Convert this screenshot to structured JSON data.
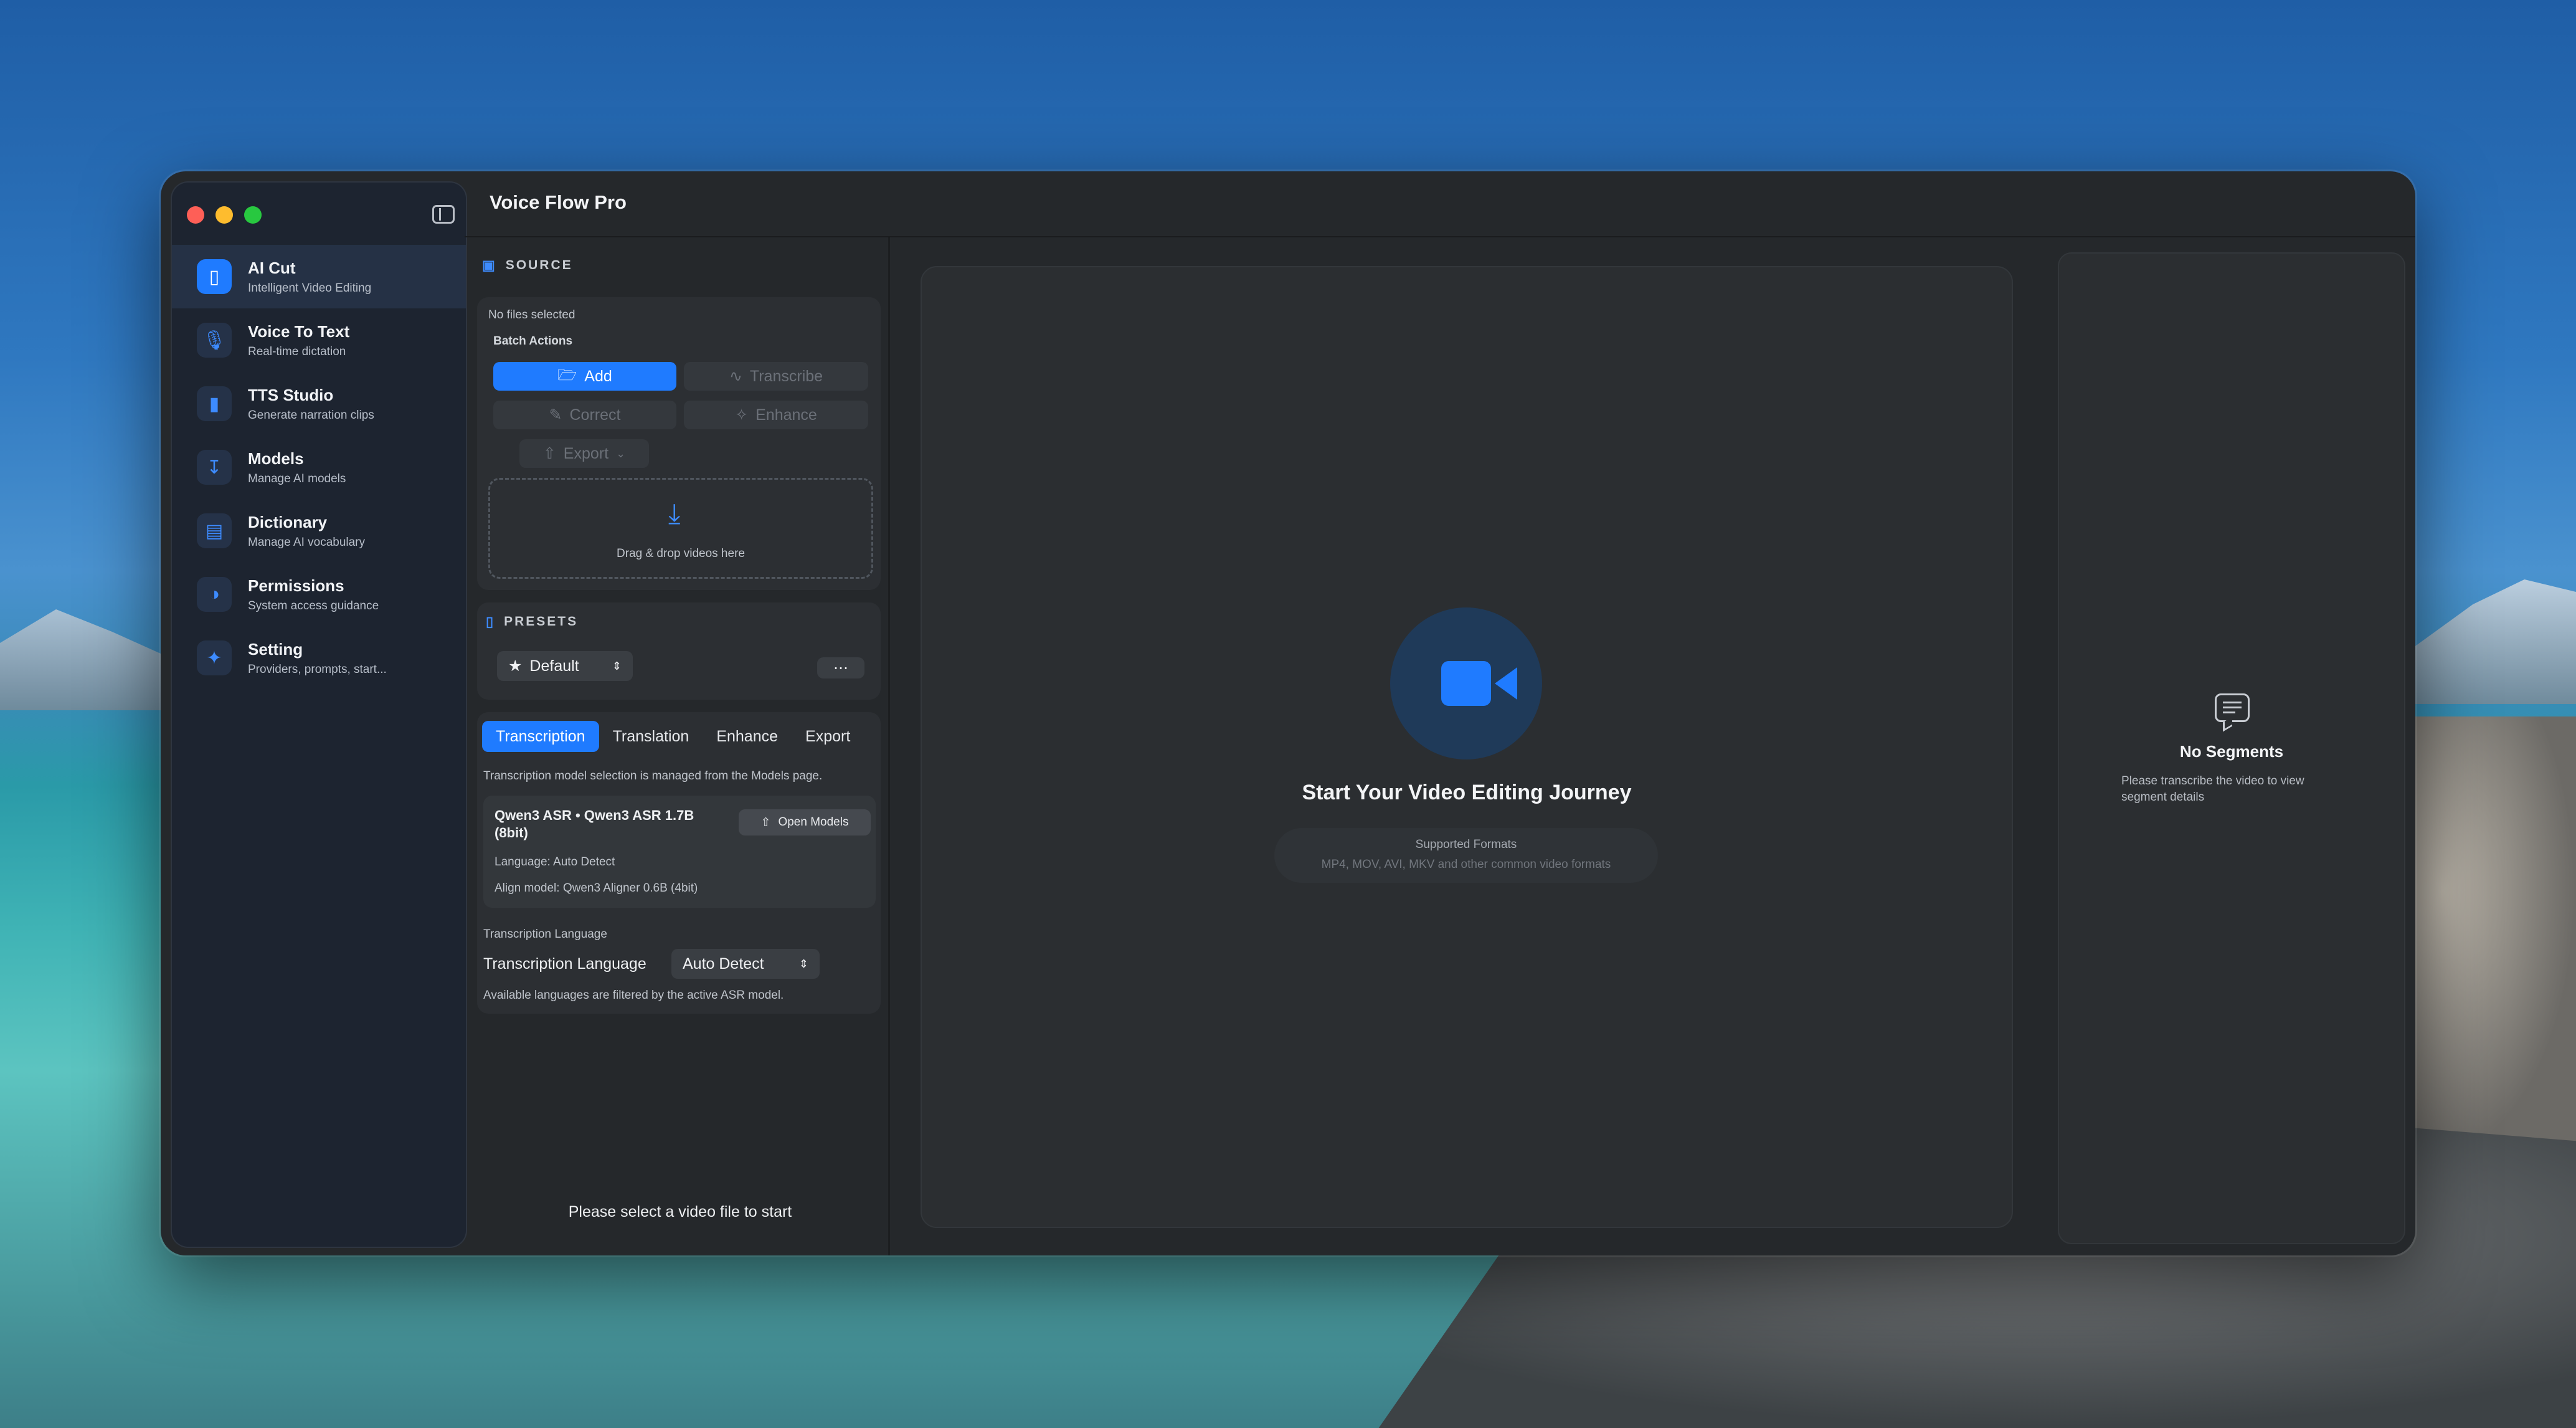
{
  "app": {
    "title": "Voice Flow Pro"
  },
  "sidebar": {
    "items": [
      {
        "title": "AI Cut",
        "subtitle": "Intelligent Video Editing",
        "icon": "waveform-icon",
        "active": true
      },
      {
        "title": "Voice To Text",
        "subtitle": "Real-time dictation",
        "icon": "mic-icon"
      },
      {
        "title": "TTS Studio",
        "subtitle": "Generate narration clips",
        "icon": "waveform-icon"
      },
      {
        "title": "Models",
        "subtitle": "Manage AI models",
        "icon": "download-box-icon"
      },
      {
        "title": "Dictionary",
        "subtitle": "Manage AI vocabulary",
        "icon": "book-icon"
      },
      {
        "title": "Permissions",
        "subtitle": "System access guidance",
        "icon": "shield-icon"
      },
      {
        "title": "Setting",
        "subtitle": "Providers, prompts, start...",
        "icon": "sparkle-icon"
      }
    ]
  },
  "source": {
    "heading": "SOURCE",
    "status": "No files selected",
    "batch_label": "Batch Actions",
    "buttons": {
      "add": "Add",
      "transcribe": "Transcribe",
      "correct": "Correct",
      "enhance": "Enhance",
      "export": "Export"
    },
    "drop_text": "Drag & drop videos here"
  },
  "presets": {
    "heading": "PRESETS",
    "selected": "Default"
  },
  "tabs": [
    "Transcription",
    "Translation",
    "Enhance",
    "Export"
  ],
  "transcription": {
    "note": "Transcription model selection is managed from the Models page.",
    "model_name": "Qwen3 ASR • Qwen3 ASR 1.7B (8bit)",
    "open_models": "Open Models",
    "language_line": "Language: Auto Detect",
    "align_line": "Align model: Qwen3 Aligner 0.6B (4bit)",
    "section_label": "Transcription Language",
    "language_label": "Transcription Language",
    "language_value": "Auto Detect",
    "footnote": "Available languages are filtered by the active ASR model."
  },
  "footer_status": "Please select a video file to start",
  "center": {
    "title": "Start Your Video Editing Journey",
    "formats_heading": "Supported Formats",
    "formats_text": "MP4, MOV, AVI, MKV and other common video formats"
  },
  "segments": {
    "title": "No Segments",
    "subtitle": "Please transcribe the video to view segment details"
  },
  "colors": {
    "accent": "#1f7bff",
    "window_bg": "#25282b",
    "sidebar_bg": "#1d2430"
  }
}
